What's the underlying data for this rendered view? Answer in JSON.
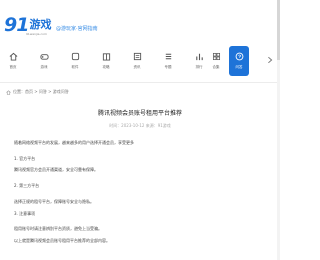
{
  "header": {
    "logo_number": "91",
    "logo_text": "游戏",
    "logo_subtext": "91wanjia.com",
    "slogan": "@游玩家·官网指南"
  },
  "nav": {
    "items": [
      {
        "label": "首页",
        "icon": "home-icon"
      },
      {
        "label": "游戏",
        "icon": "gamepad-icon"
      },
      {
        "label": "软件",
        "icon": "app-icon"
      },
      {
        "label": "攻略",
        "icon": "book-icon"
      },
      {
        "label": "资讯",
        "icon": "news-icon"
      },
      {
        "label": "专题",
        "icon": "list-icon"
      },
      {
        "label": "排行",
        "icon": "chart-icon"
      },
      {
        "label": "合集",
        "icon": "grid-icon"
      },
      {
        "label": "问答",
        "icon": "question-icon",
        "active": true
      }
    ],
    "more_icon": "chevron-right-icon",
    "accent": "#1e73d8"
  },
  "breadcrumb": {
    "text": "位置：首页 > 问答 > 游戏问答"
  },
  "article": {
    "title": "腾讯视频会员账号租用平台推荐",
    "meta": "时间：2023-10-12 来源：91游戏",
    "paragraphs": [
      "随着网络视频平台的发展，越来越多的用户选择开通会员，享受更多",
      "1. 官方平台",
      "腾讯视频官方会员开通渠道，安全可靠有保障。",
      "2. 第三方平台",
      "选择正规的租号平台，保障账号安全与隐私。",
      "3. 注意事项",
      "租用账号时请注意辨别平台资质，避免上当受骗。",
      "以上就是腾讯视频会员账号租用平台推荐的全部内容。"
    ]
  }
}
